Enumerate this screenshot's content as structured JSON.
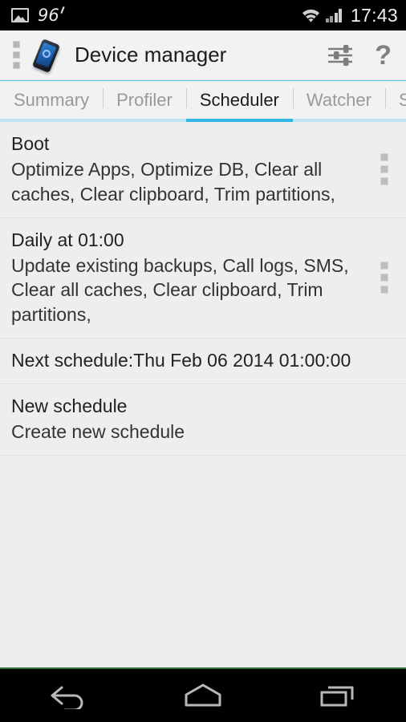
{
  "status_bar": {
    "gallery_icon": "gallery-icon",
    "notification_count": "96",
    "wifi_icon": "wifi-icon",
    "signal_icon": "signal-bars-icon",
    "time": "17:43"
  },
  "action_bar": {
    "overflow_icon": "overflow-dots-icon",
    "app_icon": "device-phone-icon",
    "title": "Device manager",
    "tune_icon": "sliders-tune-icon",
    "help_label": "?"
  },
  "tabs": [
    {
      "label": "Summary",
      "active": false
    },
    {
      "label": "Profiler",
      "active": false
    },
    {
      "label": "Scheduler",
      "active": true
    },
    {
      "label": "Watcher",
      "active": false
    },
    {
      "label": "Stats",
      "active": false
    }
  ],
  "schedules": [
    {
      "title": "Boot",
      "subtitle": "Optimize Apps, Optimize DB, Clear all caches, Clear clipboard, Trim partitions,"
    },
    {
      "title": "Daily at 01:00",
      "subtitle": "Update existing backups, Call logs, SMS, Clear all caches, Clear clipboard, Trim partitions,"
    }
  ],
  "next_schedule": "Next schedule:Thu Feb 06 2014 01:00:00",
  "new_schedule": {
    "title": "New schedule",
    "subtitle": "Create new schedule"
  },
  "nav_bar": {
    "back_icon": "back-arrow-icon",
    "home_icon": "home-icon",
    "recents_icon": "recents-icon"
  },
  "colors": {
    "accent_blue": "#33b5e5",
    "tab_underline_inactive": "#bfe3f2",
    "list_bg": "#eeeeee",
    "actionbar_bg": "#f2f2f2"
  }
}
